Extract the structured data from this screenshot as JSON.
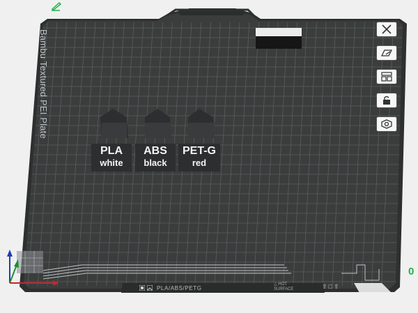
{
  "app": {
    "edit_icon": "pencil-icon",
    "accent": "#1ab54a"
  },
  "plate": {
    "label": "Bambu Textured PEI Plate",
    "filament_label": "PLA/ABS/PETG",
    "warning_text_1": "HOT",
    "warning_text_2": "SURFACE"
  },
  "toolbar": {
    "items": [
      {
        "icon": "close-plate-icon",
        "name": "close"
      },
      {
        "icon": "plate-settings-icon",
        "name": "plate-settings"
      },
      {
        "icon": "arrange-icon",
        "name": "arrange"
      },
      {
        "icon": "lock-icon",
        "name": "lock"
      },
      {
        "icon": "settings-icon",
        "name": "settings"
      }
    ]
  },
  "parts": [
    {
      "line1": "PLA",
      "line2": "white"
    },
    {
      "line1": "ABS",
      "line2": "black"
    },
    {
      "line1": "PET-G",
      "line2": "red"
    }
  ],
  "coordinate_readout": "0",
  "colors": {
    "plate": "#3b3d3d",
    "grid": "#5d6161",
    "plate_text": "#c0c4c5",
    "part_dark": "#2e2f30",
    "part_label": "#f3f3f3",
    "background": "#f0f0f0"
  }
}
